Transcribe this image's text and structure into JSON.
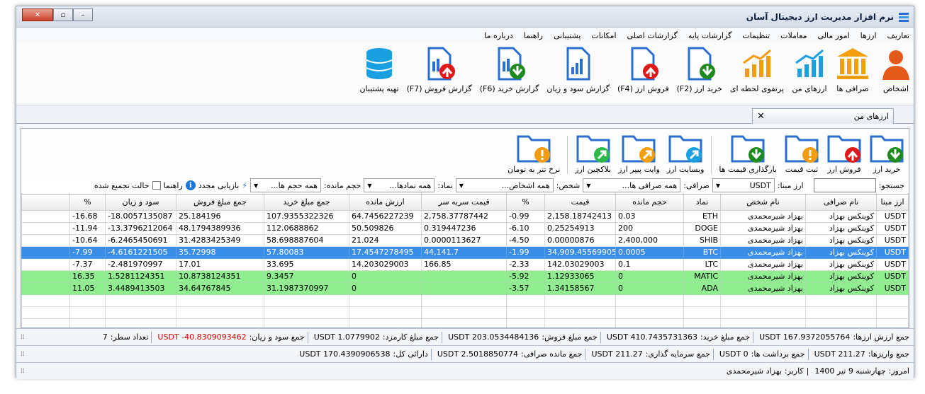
{
  "window": {
    "title": "نرم افزار مدیریت ارز دیجیتال آسان"
  },
  "menu": [
    "تعاریف",
    "ارزها",
    "امور مالی",
    "معاملات",
    "تنظیمات",
    "گزارشات پایه",
    "گزارشات اصلی",
    "امکانات",
    "پشتیبانی",
    "راهنما",
    "درباره ما"
  ],
  "ribbon": [
    {
      "label": "اشخاص",
      "icon": "person-icon"
    },
    {
      "label": "صرافی ها",
      "icon": "bank-icon"
    },
    {
      "label": "ارزهای من",
      "icon": "chart-up-icon"
    },
    {
      "label": "پرتفوی لحظه ای",
      "icon": "portfolio-chart-icon"
    },
    {
      "label": "خرید ارز (F2)",
      "icon": "doc-down-icon"
    },
    {
      "label": "فروش ارز (F4)",
      "icon": "doc-up-icon"
    },
    {
      "label": "گزارش سود و زیان",
      "icon": "report-icon"
    },
    {
      "label": "گزارش خرید (F6)",
      "icon": "report-down-icon"
    },
    {
      "label": "گزارش فروش (F7)",
      "icon": "report-up-icon"
    },
    {
      "label": "تهیه پشتیبان",
      "icon": "database-icon"
    }
  ],
  "tab": {
    "label": "ارزهای من"
  },
  "tools": [
    {
      "label": "خرید ارز",
      "badge": "down",
      "color": "#1f8a1f"
    },
    {
      "label": "فروش ارز",
      "badge": "up",
      "color": "#e01818"
    },
    {
      "label": "ثبت قیمت",
      "badge": "!",
      "color": "#f29c11"
    },
    {
      "label": "بارگذاری قیمت ها",
      "badge": "down",
      "color": "#1f8a1f"
    },
    {
      "label": "وبسایت ارز",
      "badge": "arrow",
      "color": "#1a9fe0"
    },
    {
      "label": "وایت پیپر ارز",
      "badge": "arrow",
      "color": "#f2a010"
    },
    {
      "label": "بلاکچین ارز",
      "badge": "arrow",
      "color": "#2bb84a"
    },
    {
      "label": "نرخ تتر به تومان",
      "badge": "!",
      "color": "#f29c11"
    }
  ],
  "filters": {
    "search_label": "جستجو:",
    "base_label": "ارز مبنا:",
    "base_value": "USDT",
    "exchange_label": "صرافی:",
    "exchange_value": "همه صرافی ها...",
    "person_label": "شخص:",
    "person_value": "همه اشخاص...",
    "symbol_label": "نماد:",
    "symbol_value": "همه نمادها...",
    "volume_label": "حجم مانده:",
    "volume_value": "همه حجم ها...",
    "refresh_label": "بازیابی مجدد",
    "help_label": "راهنما",
    "group_label": "حالت تجمیع شده"
  },
  "table": {
    "headers": [
      "ارز مبنا",
      "نام صرافی",
      "نام شخص",
      "نماد",
      "حجم مانده",
      "قیمت",
      "%",
      "قیمت سربه سر",
      "ارزش مانده",
      "جمع مبلغ خرید",
      "جمع مبلغ فروش",
      "سود و زیان",
      "%",
      ""
    ],
    "rows": [
      {
        "style": "",
        "cells": [
          "USDT",
          "کوینکس بهزاد",
          "بهزاد شیرمحمدی",
          "ETH",
          "0.03",
          "2,158.18742413",
          "-0.99",
          "2,758.37787442",
          "64.7456227239",
          "107.9355322326",
          "25.184196",
          "-18.0057135087",
          "-16.68",
          ""
        ]
      },
      {
        "style": "",
        "cells": [
          "USDT",
          "کوینکس بهزاد",
          "بهزاد شیرمحمدی",
          "DOGE",
          "200",
          "0.25254913",
          "-6.10",
          "0.319447236",
          "50.509826",
          "112.0688862",
          "48.1794389936",
          "-13.3796212064",
          "-11.94",
          ""
        ]
      },
      {
        "style": "",
        "cells": [
          "USDT",
          "کوینکس بهزاد",
          "بهزاد شیرمحمدی",
          "SHIB",
          "2,400,000",
          "0.00000876",
          "-4.50",
          "0.0000113627",
          "21.024",
          "58.698887604",
          "31.4283425349",
          "-6.2465450691",
          "-10.64",
          ""
        ]
      },
      {
        "style": "sel",
        "cells": [
          "USDT",
          "کوینکس بهزاد",
          "بهزاد شیرمحمدی",
          "BTC",
          "0.0005",
          "34,909.45569905",
          "-1.99",
          "44,141.7",
          "17.4547278495",
          "57.80083",
          "35.72998",
          "-4.6161221505",
          "-7.99",
          ""
        ]
      },
      {
        "style": "",
        "cells": [
          "USDT",
          "کوینکس بهزاد",
          "بهزاد شیرمحمدی",
          "LTC",
          "0.1",
          "142.03029003",
          "-2.33",
          "166.85",
          "14.203029003",
          "33.695",
          "17.01",
          "-2.481970997",
          "-7.37",
          ""
        ]
      },
      {
        "style": "green",
        "cells": [
          "USDT",
          "کوینکس بهزاد",
          "بهزاد شیرمحمدی",
          "MATIC",
          "0",
          "1.12933065",
          "-5.92",
          "",
          "0",
          "9.3457",
          "10.8738124351",
          "1.5281124351",
          "16.35",
          ""
        ]
      },
      {
        "style": "green",
        "cells": [
          "USDT",
          "کوینکس بهزاد",
          "بهزاد شیرمحمدی",
          "ADA",
          "0",
          "1.34158567",
          "-3.57",
          "",
          "0",
          "31.1987370997",
          "34.64767845",
          "3.4489413503",
          "11.05",
          ""
        ]
      }
    ]
  },
  "status1": {
    "l1": "جمع ارزش ارزها:",
    "v1": "USDT 167.9372055764",
    "l2": "جمع مبلغ خرید:",
    "v2": "USDT 410.7435731363",
    "l3": "جمع مبلغ فروش:",
    "v3": "USDT 203.0534484136",
    "l4": "جمع مبلغ کارمزد:",
    "v4": "USDT 1.0779902",
    "l5": "جمع سود و زیان:",
    "v5": "USDT -40.8309093462",
    "l6": "تعداد سطر:",
    "v6": "7"
  },
  "status2": {
    "l1": "جمع واریزها:",
    "v1": "USDT 211.27",
    "l2": "جمع برداشت ها:",
    "v2": "USDT 0",
    "l3": "جمع سرمایه گذاری:",
    "v3": "USDT 211.27",
    "l4": "جمع مانده صرافی:",
    "v4": "USDT 2.5018850774",
    "l5": "دارائی کل:",
    "v5": "USDT 170.4390906538"
  },
  "status3": {
    "l1": "امروز:",
    "v1": "چهارشنبه 9 تیر 1400",
    "sep": "|",
    "l2": "کاربر:",
    "v2": "بهزاد شیرمحمدی"
  }
}
